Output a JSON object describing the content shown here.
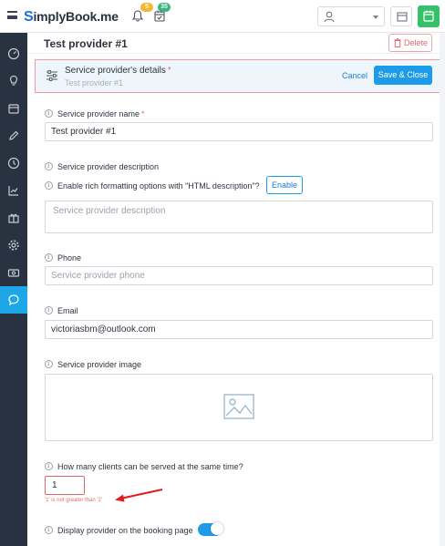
{
  "header": {
    "logo_s": "S",
    "logo_text": "implyBook",
    "logo_suffix": ".me",
    "notifications_count": "5",
    "calendar_count": "35"
  },
  "page": {
    "title": "Test provider #1",
    "delete_label": "Delete"
  },
  "details_bar": {
    "title": "Service provider's details",
    "required_mark": "*",
    "subtitle": "Test provider #1",
    "cancel_label": "Cancel",
    "save_label": "Save & Close"
  },
  "form": {
    "name": {
      "label": "Service provider name",
      "required_mark": "*",
      "value": "Test provider #1"
    },
    "description": {
      "label": "Service provider description",
      "rich_label": "Enable rich formatting options with \"HTML description\"?",
      "enable_label": "Enable",
      "placeholder": "Service provider description"
    },
    "phone": {
      "label": "Phone",
      "placeholder": "Service provider phone"
    },
    "email": {
      "label": "Email",
      "value": "victoriasbm@outlook.com"
    },
    "image": {
      "label": "Service provider image"
    },
    "capacity": {
      "label": "How many clients can be served at the same time?",
      "value": "1",
      "error": "'1' is not greater than '2'"
    },
    "display": {
      "label": "Display provider on the booking page",
      "enabled": true
    }
  },
  "colors": {
    "accent": "#1e9be8",
    "sidebar": "#283241",
    "error": "#e06b72",
    "success": "#36c06a"
  },
  "sidebar_icons": [
    "dashboard-icon",
    "lightbulb-icon",
    "calendar-icon",
    "pencil-icon",
    "clock-icon",
    "chart-icon",
    "gift-icon",
    "gear-icon",
    "cash-icon",
    "chat-icon"
  ]
}
